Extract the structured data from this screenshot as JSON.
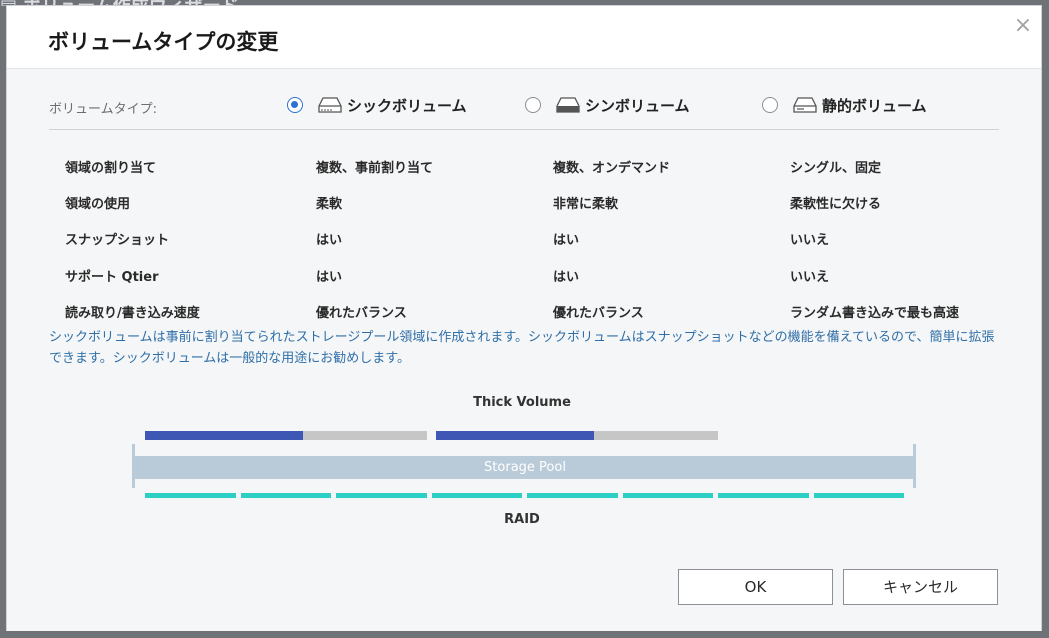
{
  "dialog": {
    "title": "ボリュームタイプの変更",
    "close_symbol": "×"
  },
  "volume_type": {
    "label": "ボリュームタイプ:",
    "options": [
      {
        "label": "シックボリューム",
        "checked": true,
        "icon": "thick-volume-icon"
      },
      {
        "label": "シンボリューム",
        "checked": false,
        "icon": "thin-volume-icon"
      },
      {
        "label": "静的ボリューム",
        "checked": false,
        "icon": "static-volume-icon"
      }
    ]
  },
  "comparison": {
    "rows": [
      {
        "feature": "領域の割り当て",
        "thick": "複数、事前割り当て",
        "thin": "複数、オンデマンド",
        "static": "シングル、固定"
      },
      {
        "feature": "領域の使用",
        "thick": "柔軟",
        "thin": "非常に柔軟",
        "static": "柔軟性に欠ける"
      },
      {
        "feature": "スナップショット",
        "thick": "はい",
        "thin": "はい",
        "static": "いいえ"
      },
      {
        "feature": "サポート Qtier",
        "thick": "はい",
        "thin": "はい",
        "static": "いいえ"
      },
      {
        "feature": "読み取り/書き込み速度",
        "thick": "優れたバランス",
        "thin": "優れたバランス",
        "static": "ランダム書き込みで最も高速"
      }
    ]
  },
  "description": "シックボリュームは事前に割り当てられたストレージプール領域に作成されます。シックボリュームはスナップショットなどの機能を備えているので、簡単に拡張できます。シックボリュームは一般的な用途にお勧めします。",
  "diagram": {
    "volume_label": "Thick Volume",
    "pool_label": "Storage Pool",
    "raid_label": "RAID",
    "volumes": [
      {
        "used_fraction": 0.56
      },
      {
        "used_fraction": 0.56
      }
    ],
    "raid_segments": 8,
    "colors": {
      "used": "#3f57b4",
      "free": "#c6c6c6",
      "pool": "#b9cbd8",
      "raid": "#2ccfc3"
    }
  },
  "buttons": {
    "ok": "OK",
    "cancel": "キャンセル"
  },
  "colors": {
    "accent": "#2e6fd8",
    "description_text": "#2f6fa8"
  }
}
